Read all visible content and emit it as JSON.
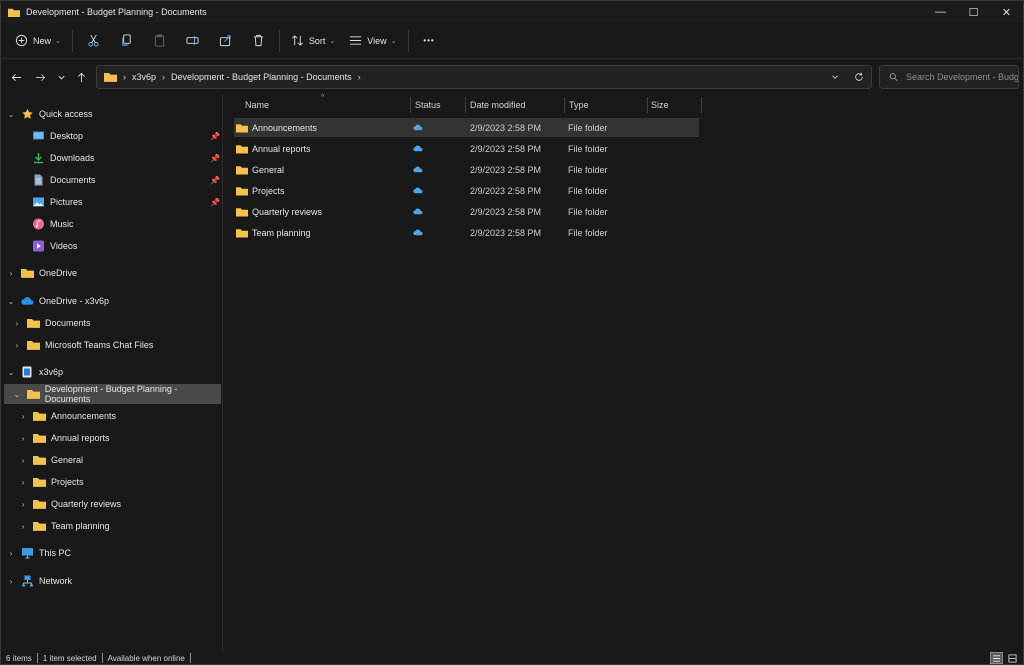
{
  "window": {
    "title": "Development - Budget Planning - Documents",
    "controls": [
      "—",
      "☐",
      "✕"
    ]
  },
  "toolbar": {
    "new_label": "New",
    "sort_label": "Sort",
    "view_label": "View",
    "more_label": "•••"
  },
  "address": {
    "crumbs": [
      "x3v6p",
      "Development - Budget Planning - Documents"
    ],
    "search_placeholder": "Search Development - Budg..."
  },
  "sidebar": {
    "quick_access": "Quick access",
    "quick_items": [
      "Desktop",
      "Downloads",
      "Documents",
      "Pictures",
      "Music",
      "Videos"
    ],
    "onedrive": "OneDrive",
    "onedrive_org": "OneDrive - x3v6p",
    "onedrive_org_items": [
      "Documents",
      "Microsoft Teams Chat Files"
    ],
    "site": "x3v6p",
    "library": "Development - Budget Planning - Documents",
    "library_items": [
      "Announcements",
      "Annual reports",
      "General",
      "Projects",
      "Quarterly reviews",
      "Team planning"
    ],
    "this_pc": "This PC",
    "network": "Network"
  },
  "columns": {
    "name": "Name",
    "status": "Status",
    "date": "Date modified",
    "type": "Type",
    "size": "Size"
  },
  "files": [
    {
      "name": "Announcements",
      "date": "2/9/2023 2:58 PM",
      "type": "File folder"
    },
    {
      "name": "Annual reports",
      "date": "2/9/2023 2:58 PM",
      "type": "File folder"
    },
    {
      "name": "General",
      "date": "2/9/2023 2:58 PM",
      "type": "File folder"
    },
    {
      "name": "Projects",
      "date": "2/9/2023 2:58 PM",
      "type": "File folder"
    },
    {
      "name": "Quarterly reviews",
      "date": "2/9/2023 2:58 PM",
      "type": "File folder"
    },
    {
      "name": "Team planning",
      "date": "2/9/2023 2:58 PM",
      "type": "File folder"
    }
  ],
  "statusbar": {
    "count": "6 items",
    "selected": "1 item selected",
    "availability": "Available when online"
  },
  "colors": {
    "folder": "#f2c14e",
    "cloud": "#4fa3e8",
    "background": "#191919"
  }
}
